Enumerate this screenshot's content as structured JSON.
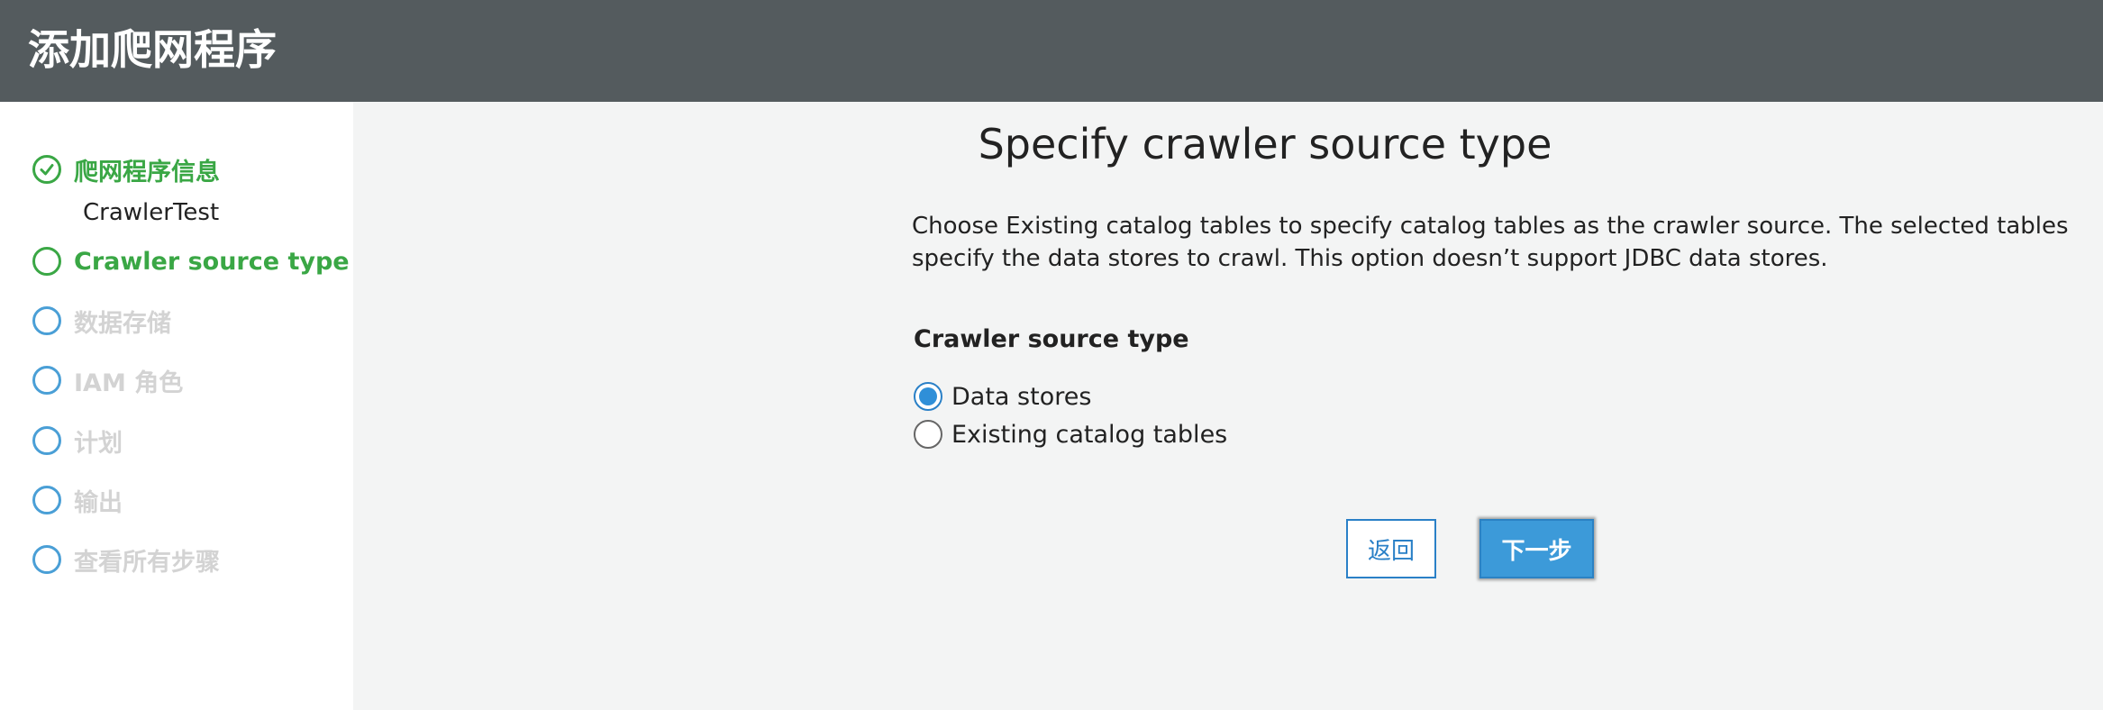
{
  "header": {
    "title": "添加爬网程序"
  },
  "sidebar": {
    "steps": [
      {
        "label": "爬网程序信息",
        "state": "completed",
        "sublabel": "CrawlerTest",
        "icon": "check-circle-icon"
      },
      {
        "label": "Crawler source type",
        "state": "current",
        "icon": "circle-icon"
      },
      {
        "label": "数据存储",
        "state": "pending",
        "icon": "circle-icon"
      },
      {
        "label": "IAM 角色",
        "state": "pending",
        "icon": "circle-icon"
      },
      {
        "label": "计划",
        "state": "pending",
        "icon": "circle-icon"
      },
      {
        "label": "输出",
        "state": "pending",
        "icon": "circle-icon"
      },
      {
        "label": "查看所有步骤",
        "state": "pending",
        "icon": "circle-icon"
      }
    ]
  },
  "main": {
    "title": "Specify crawler source type",
    "description": "Choose Existing catalog tables to specify catalog tables as the crawler source. The selected tables specify the data stores to crawl. This option doesn’t support JDBC data stores.",
    "field_label": "Crawler source type",
    "options": [
      {
        "label": "Data stores",
        "selected": true
      },
      {
        "label": "Existing catalog tables",
        "selected": false
      }
    ],
    "back_label": "返回",
    "next_label": "下一步"
  },
  "colors": {
    "header_bg": "#545b5e",
    "completed_green": "#3aa745",
    "pending_blue": "#4a9fd6",
    "pending_text": "#d3d3d3",
    "primary_blue": "#3c9ad9",
    "link_blue": "#2a80c7",
    "page_bg": "#f3f4f4"
  }
}
